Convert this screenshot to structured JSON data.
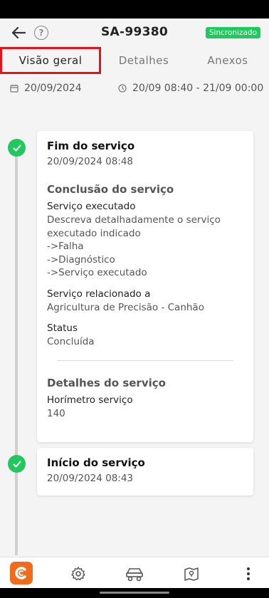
{
  "header": {
    "title": "SA-99380",
    "sync_badge": "Sincronizado"
  },
  "tabs": [
    {
      "label": "Visão geral",
      "active": true
    },
    {
      "label": "Detalhes",
      "active": false
    },
    {
      "label": "Anexos",
      "active": false
    }
  ],
  "info": {
    "date": "20/09/2024",
    "time_range": "20/09 08:40 - 21/09 00:00"
  },
  "timeline": [
    {
      "title": "Fim do serviço",
      "date": "20/09/2024 08:48",
      "section_conclusion": "Conclusão do serviço",
      "fields": [
        {
          "label": "Serviço executado",
          "value": "Descreva detalhadamente o serviço\nexecutado indicado\n->Falha\n->Diagnóstico\n->Serviço executado"
        },
        {
          "label": "Serviço relacionado a",
          "value": "Agricultura de Precisão - Canhão"
        },
        {
          "label": "Status",
          "value": "Concluída"
        }
      ],
      "section_details": "Detalhes do serviço",
      "detail_fields": [
        {
          "label": "Horímetro serviço",
          "value": "140"
        }
      ]
    },
    {
      "title": "Início do serviço",
      "date": "20/09/2024 08:43"
    }
  ],
  "bottom_nav": [
    "logo-icon",
    "settings-icon",
    "machinery-icon",
    "map-icon",
    "more-icon"
  ],
  "colors": {
    "accent_green": "#1fc95e",
    "tab_highlight": "#e0161f",
    "brand_orange": "#f26b1d"
  }
}
